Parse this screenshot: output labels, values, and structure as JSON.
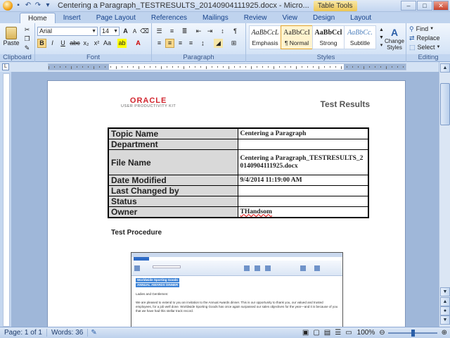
{
  "window": {
    "title": "Centering a Paragraph_TESTRESULTS_20140904111925.docx - Micro...",
    "context_tab": "Table Tools"
  },
  "tabs": [
    "Home",
    "Insert",
    "Page Layout",
    "References",
    "Mailings",
    "Review",
    "View",
    "Design",
    "Layout"
  ],
  "ribbon": {
    "clipboard": {
      "label": "Clipboard",
      "paste": "Paste"
    },
    "font": {
      "label": "Font",
      "family": "Arial",
      "size": "14"
    },
    "paragraph": {
      "label": "Paragraph"
    },
    "styles": {
      "label": "Styles",
      "items": [
        {
          "sample": "AaBbCcL",
          "name": "Emphasis"
        },
        {
          "sample": "AaBbCcI",
          "name": "¶ Normal"
        },
        {
          "sample": "AaBbCcl",
          "name": "Strong"
        },
        {
          "sample": "AaBbCc.",
          "name": "Subtitle"
        }
      ],
      "change_styles": "Change Styles"
    },
    "editing": {
      "label": "Editing",
      "find": "Find",
      "replace": "Replace",
      "select": "Select"
    }
  },
  "document": {
    "logo_word": "ORACLE",
    "logo_sub": "USER PRODUCTIVITY KIT",
    "heading": "Test Results",
    "table": [
      {
        "label": "Topic Name",
        "value": "Centering a Paragraph"
      },
      {
        "label": "Department",
        "value": ""
      },
      {
        "label": "File Name",
        "value": "Centering a Paragraph_TESTRESULTS_20140904111925.docx"
      },
      {
        "label": "Date Modified",
        "value": "9/4/2014 11:19:00 AM"
      },
      {
        "label": "Last Changed by",
        "value": ""
      },
      {
        "label": "Status",
        "value": ""
      },
      {
        "label": "Owner",
        "value": "THandsom"
      }
    ],
    "procedure_heading": "Test Procedure",
    "embedded": {
      "line1": "Worldwide Sporting Goods",
      "line2": "ANNUAL AWARDS DINNER",
      "line3": "Ladies and Gentlemen:",
      "line4": "We are pleased to extend to you an invitation to the Annual Awards dinner.  This is our opportunity to thank you, our valued and trusted employees, for a job well done.  Worldwide Sporting Goods has once again surpassed our sales objectives for the year—and it is because of you that we have had this stellar track record."
    }
  },
  "status": {
    "page": "Page: 1 of 1",
    "words": "Words: 36",
    "zoom": "100%"
  }
}
